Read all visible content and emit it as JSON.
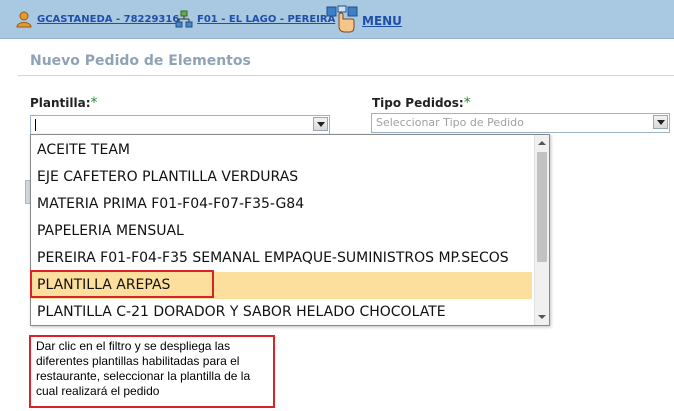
{
  "topbar": {
    "user_label": "GCASTANEDA - 78229316",
    "branch_label": "F01 - EL LAGO - PEREIRA",
    "menu_label": "MENU",
    "icons": {
      "user": "user-icon",
      "branch": "branch-icon",
      "menu": "menu-hand-icon"
    }
  },
  "page": {
    "title": "Nuevo Pedido de Elementos"
  },
  "form": {
    "plantilla": {
      "label": "Plantilla:",
      "required_mark": "*",
      "value": ""
    },
    "tipo_pedidos": {
      "label": "Tipo Pedidos:",
      "required_mark": "*",
      "placeholder": "Seleccionar Tipo de Pedido"
    }
  },
  "dropdown": {
    "options": [
      "ACEITE TEAM",
      "EJE CAFETERO PLANTILLA VERDURAS",
      "MATERIA PRIMA F01-F04-F07-F35-G84",
      "PAPELERIA MENSUAL",
      "PEREIRA F01-F04-F35 SEMANAL EMPAQUE-SUMINISTROS MP.SECOS",
      "PLANTILLA AREPAS",
      "PLANTILLA C-21 DORADOR Y SABOR HELADO CHOCOLATE"
    ],
    "highlighted_index": 5
  },
  "annotation": {
    "note": "Dar clic en el filtro y se despliega las diferentes plantillas habilitadas para el restaurante, seleccionar la plantilla de la cual realizará el pedido",
    "highlight_color": "#d9232b"
  },
  "colors": {
    "header_bg": "#a9c8e2",
    "link": "#1f4fa8",
    "highlight": "#fcdf9d"
  }
}
